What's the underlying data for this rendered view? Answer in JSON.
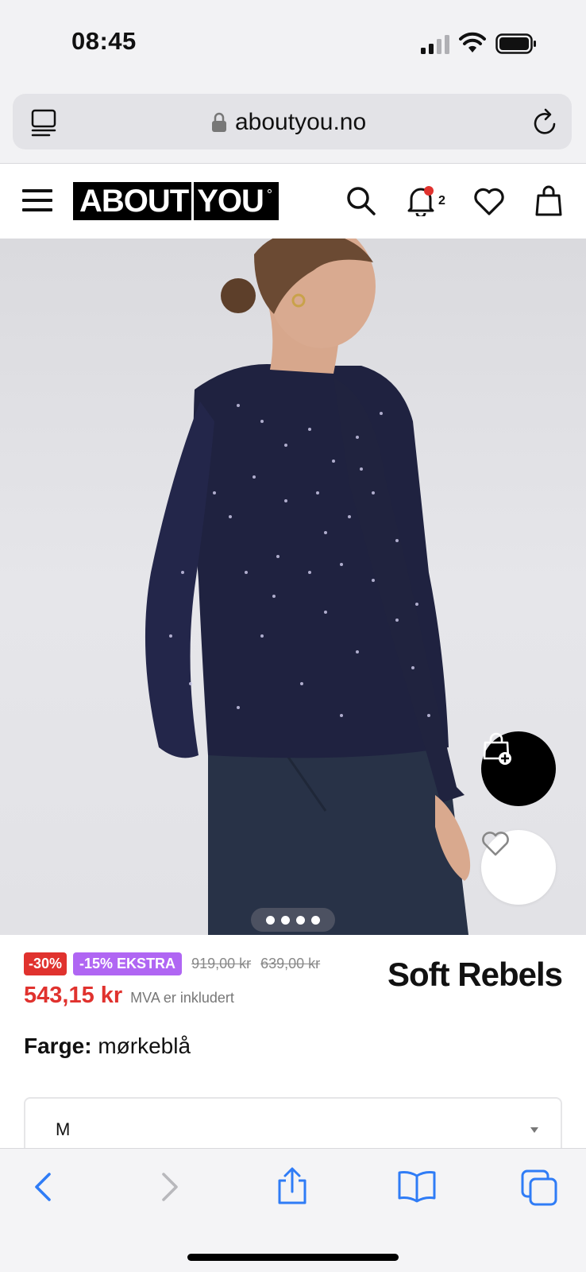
{
  "status_bar": {
    "time": "08:45"
  },
  "browser": {
    "url": "aboutyou.no"
  },
  "site_header": {
    "logo_left": "ABOUT",
    "logo_right": "YOU",
    "logo_mark": "°",
    "notification_count": "2",
    "icons": [
      "menu-icon",
      "search-icon",
      "bell-icon",
      "heart-icon",
      "bag-icon"
    ]
  },
  "gallery": {
    "image_count": 4,
    "active_index": 3
  },
  "product": {
    "discount_badge": "-30%",
    "extra_badge": "-15% EKSTRA",
    "old_price_1": "919,00 kr",
    "old_price_2": "639,00 kr",
    "price": "543,15 kr",
    "vat_note": "MVA er inkludert",
    "brand": "Soft Rebels",
    "color_label": "Farge:",
    "color_value": "mørkeblå",
    "size_value": "M"
  },
  "colors": {
    "sale_red": "#e0322e",
    "extra_purple": "#b066f3",
    "ios_blue": "#2f7cf6"
  }
}
